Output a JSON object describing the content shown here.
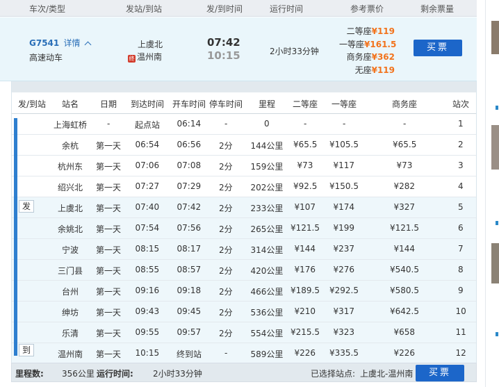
{
  "header": {
    "train": "车次/类型",
    "stations": "发站/到站",
    "times": "发/到时间",
    "duration": "运行时间",
    "price": "参考票价",
    "remaining": "剩余票量"
  },
  "train": {
    "number": "G7541",
    "detail_label": "详情",
    "type": "高速动车",
    "from": "上虞北",
    "to_badge": "终",
    "to": "温州南",
    "depart": "07:42",
    "arrive": "10:15",
    "duration": "2小时33分钟",
    "prices": [
      {
        "label": "二等座",
        "value": "¥119"
      },
      {
        "label": "一等座",
        "value": "¥161.5"
      },
      {
        "label": "商务座",
        "value": "¥362"
      },
      {
        "label": "无座",
        "value": "¥119"
      }
    ],
    "buy_label": "买票"
  },
  "stop_columns": [
    "发/到站",
    "站名",
    "日期",
    "到达时间",
    "开车时间",
    "停车时间",
    "里程",
    "二等座",
    "一等座",
    "商务座",
    "站次"
  ],
  "stops": [
    {
      "name": "上海虹桥",
      "day": "-",
      "arrive": "起点站",
      "depart": "06:14",
      "stop": "-",
      "dist": "0",
      "second": "-",
      "first": "-",
      "business": "-",
      "seq": "1"
    },
    {
      "name": "余杭",
      "day": "第一天",
      "arrive": "06:54",
      "depart": "06:56",
      "stop": "2分",
      "dist": "144公里",
      "second": "¥65.5",
      "first": "¥105.5",
      "business": "¥65.5",
      "seq": "2"
    },
    {
      "name": "杭州东",
      "day": "第一天",
      "arrive": "07:06",
      "depart": "07:08",
      "stop": "2分",
      "dist": "159公里",
      "second": "¥73",
      "first": "¥117",
      "business": "¥73",
      "seq": "3"
    },
    {
      "name": "绍兴北",
      "day": "第一天",
      "arrive": "07:27",
      "depart": "07:29",
      "stop": "2分",
      "dist": "202公里",
      "second": "¥92.5",
      "first": "¥150.5",
      "business": "¥282",
      "seq": "4"
    },
    {
      "name": "上虞北",
      "day": "第一天",
      "arrive": "07:40",
      "depart": "07:42",
      "stop": "2分",
      "dist": "233公里",
      "second": "¥107",
      "first": "¥174",
      "business": "¥327",
      "seq": "5"
    },
    {
      "name": "余姚北",
      "day": "第一天",
      "arrive": "07:54",
      "depart": "07:56",
      "stop": "2分",
      "dist": "265公里",
      "second": "¥121.5",
      "first": "¥199",
      "business": "¥121.5",
      "seq": "6"
    },
    {
      "name": "宁波",
      "day": "第一天",
      "arrive": "08:15",
      "depart": "08:17",
      "stop": "2分",
      "dist": "314公里",
      "second": "¥144",
      "first": "¥237",
      "business": "¥144",
      "seq": "7"
    },
    {
      "name": "三门县",
      "day": "第一天",
      "arrive": "08:55",
      "depart": "08:57",
      "stop": "2分",
      "dist": "420公里",
      "second": "¥176",
      "first": "¥276",
      "business": "¥540.5",
      "seq": "8"
    },
    {
      "name": "台州",
      "day": "第一天",
      "arrive": "09:16",
      "depart": "09:18",
      "stop": "2分",
      "dist": "466公里",
      "second": "¥189.5",
      "first": "¥292.5",
      "business": "¥580.5",
      "seq": "9"
    },
    {
      "name": "绅坊",
      "day": "第一天",
      "arrive": "09:43",
      "depart": "09:45",
      "stop": "2分",
      "dist": "536公里",
      "second": "¥210",
      "first": "¥317",
      "business": "¥642.5",
      "seq": "10"
    },
    {
      "name": "乐清",
      "day": "第一天",
      "arrive": "09:55",
      "depart": "09:57",
      "stop": "2分",
      "dist": "554公里",
      "second": "¥215.5",
      "first": "¥323",
      "business": "¥658",
      "seq": "11"
    },
    {
      "name": "温州南",
      "day": "第一天",
      "arrive": "10:15",
      "depart": "终到站",
      "stop": "-",
      "dist": "589公里",
      "second": "¥226",
      "first": "¥335.5",
      "business": "¥226",
      "seq": "12"
    }
  ],
  "rail": {
    "depart_label": "发",
    "arrive_label": "到"
  },
  "footer": {
    "distance_label": "里程数:",
    "distance_value": "356公里",
    "duration_label": "运行时间:",
    "duration_value": "2小时33分钟",
    "selected_label": "已选择站点:",
    "selected_value": "上虞北-温州南",
    "buy_label": "买票"
  },
  "colors": {
    "accent": "#1c66c9",
    "price": "#f2731c",
    "highlight_row": "#eef7fb"
  }
}
